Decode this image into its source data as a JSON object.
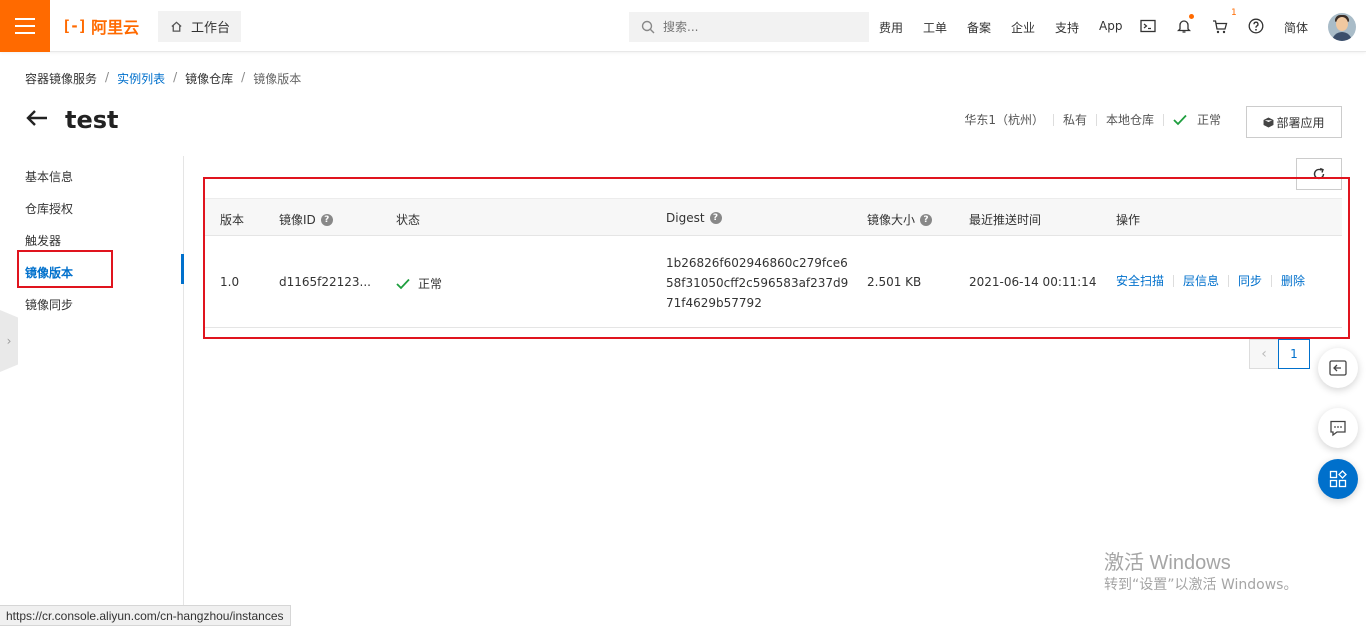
{
  "header": {
    "logo_text": "阿里云",
    "workbench_label": "工作台",
    "search_placeholder": "搜索...",
    "nav": {
      "fees": "费用",
      "tickets": "工单",
      "icp": "备案",
      "enterprise": "企业",
      "support": "支持",
      "app": "App",
      "language": "简体"
    },
    "cart_count": "1"
  },
  "breadcrumb": {
    "items": [
      "容器镜像服务",
      "实例列表",
      "镜像仓库",
      "镜像版本"
    ],
    "separator": "/"
  },
  "page": {
    "title": "test",
    "region": "华东1（杭州）",
    "visibility": "私有",
    "source": "本地仓库",
    "status": "正常",
    "deploy_label": "部署应用"
  },
  "sidenav": {
    "items": [
      "基本信息",
      "仓库授权",
      "触发器",
      "镜像版本",
      "镜像同步"
    ],
    "active_index": 3
  },
  "table": {
    "columns": [
      "版本",
      "镜像ID",
      "状态",
      "Digest",
      "镜像大小",
      "最近推送时间",
      "操作"
    ],
    "rows": [
      {
        "version": "1.0",
        "image_id": "d1165f22123...",
        "status": "正常",
        "digest_lines": [
          "1b26826f602946860c279fce6",
          "58f31050cff2c596583af237d9",
          "71f4629b57792"
        ],
        "size": "2.501 KB",
        "pushed_at": "2021-06-14 00:11:14",
        "actions": [
          "安全扫描",
          "层信息",
          "同步",
          "删除"
        ]
      }
    ]
  },
  "pagination": {
    "current_page": "1"
  },
  "watermark": {
    "line1": "激活 Windows",
    "line2": "转到“设置”以激活 Windows。"
  },
  "statusbar": {
    "url": "https://cr.console.aliyun.com/cn-hangzhou/instances"
  },
  "colors": {
    "brand": "#ff6a00",
    "link": "#0070cc",
    "success": "#1e9e3e",
    "highlight_box": "#e0141e"
  }
}
